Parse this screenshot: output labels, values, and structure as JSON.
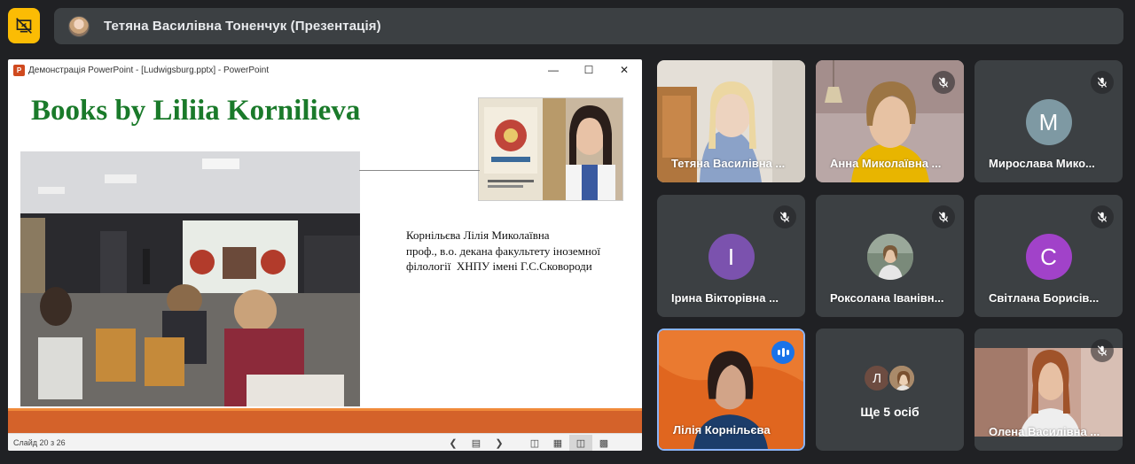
{
  "topbar": {
    "presenter_title": "Тетяна Василівна Тоненчук (Презентація)"
  },
  "powerpoint": {
    "window_title": "Демонстрація PowerPoint - [Ludwigsburg.pptx] - PowerPoint",
    "logo_letter": "P",
    "slide": {
      "title": "Books by Liliia Kornilieva",
      "author_text": "Корнільєва Лілія Миколаївна\nпроф., в.о. декана факультету іноземної\nфілології  ХНПУ імені Г.С.Сковороди"
    },
    "status": {
      "slide_indicator": "Слайд 20 з 26"
    }
  },
  "participants": [
    {
      "name": "Тетяна Василівна ...",
      "type": "video",
      "muted": false
    },
    {
      "name": "Анна Миколаївна ...",
      "type": "video",
      "muted": true
    },
    {
      "name": "Мирослава Мико...",
      "type": "letter",
      "letter": "М",
      "color": "#7e99a3",
      "muted": true
    },
    {
      "name": "Ірина Вікторівна ...",
      "type": "letter",
      "letter": "І",
      "color": "#7b52ae",
      "muted": true
    },
    {
      "name": "Роксолана Іванівн...",
      "type": "photo",
      "muted": true
    },
    {
      "name": "Світлана Борисів...",
      "type": "letter",
      "letter": "С",
      "color": "#a142c9",
      "muted": true
    },
    {
      "name": "Лілія Корнільєва",
      "type": "video",
      "speaking": true
    },
    {
      "more_count_text": "Ще 5 осіб",
      "avatar_letter": "Л"
    },
    {
      "name": "Олена Василівна ...",
      "type": "video",
      "muted": true
    }
  ],
  "colors": {
    "background": "#202124",
    "tile": "#3c4043",
    "present_accent": "#fbbc04",
    "speaking_border": "#8ab4f8",
    "slide_title_green": "#1a7a2a",
    "slide_band_orange": "#d4622a"
  }
}
